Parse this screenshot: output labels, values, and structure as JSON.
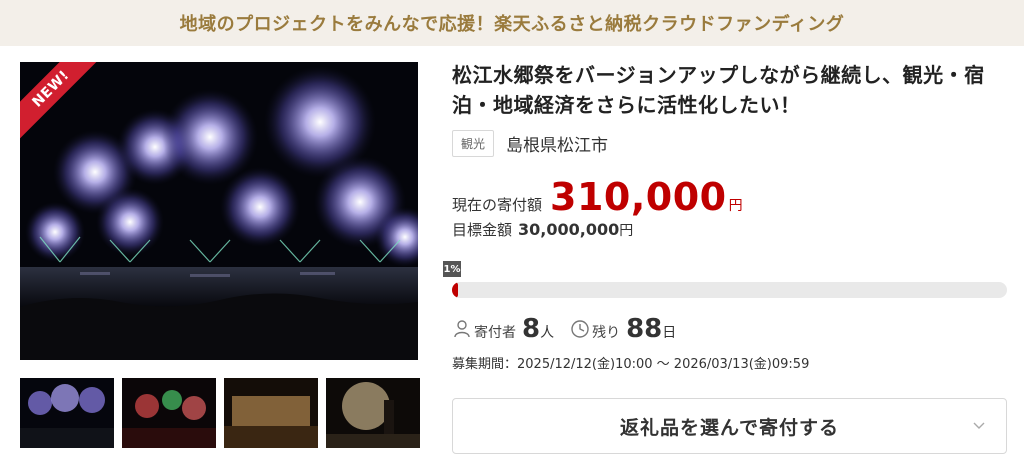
{
  "banner": {
    "text": "地域のプロジェクトをみんなで応援！楽天ふるさと納税クラウドファンディング"
  },
  "project": {
    "title": "松江水郷祭をバージョンアップしながら継続し、観光・宿泊・地域経済をさらに活性化したい！",
    "badge_new": "NEW!",
    "tag": "観光",
    "location": "島根県松江市"
  },
  "funding": {
    "current_label": "現在の寄付額",
    "current_amount": "310,000",
    "current_unit": "円",
    "goal_label": "目標金額",
    "goal_amount": "30,000,000",
    "goal_unit": "円",
    "progress_percent": 1,
    "progress_label": "1%"
  },
  "stats": {
    "donors_label": "寄付者",
    "donors_count": "8",
    "donors_unit": "人",
    "remaining_label": "残り",
    "remaining_days": "88",
    "remaining_unit": "日"
  },
  "period": {
    "text": "募集期間：2025/12/12(金)10:00 〜 2026/03/13(金)09:59"
  },
  "cta": {
    "label": "返礼品を選んで寄付する",
    "icon": "chevron-down-icon"
  },
  "gallery": {
    "thumb_count": 4
  },
  "colors": {
    "accent": "#bf0000",
    "banner_bg": "#f3efe9",
    "banner_text": "#9a7b3d"
  }
}
